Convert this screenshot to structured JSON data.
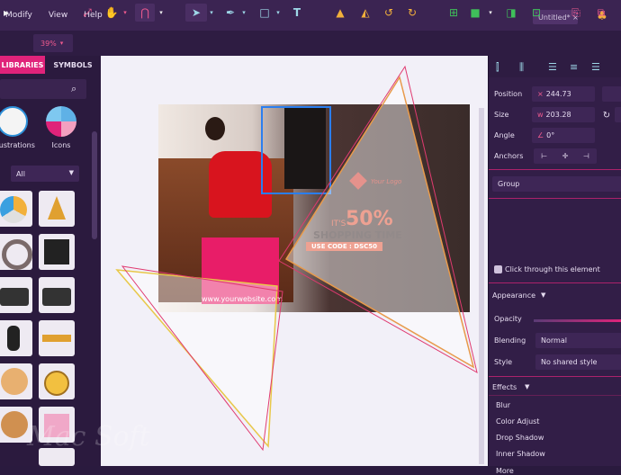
{
  "menu": [
    "Modify",
    "View",
    "Help"
  ],
  "document_tab": {
    "title": "Untitled*",
    "close": "×"
  },
  "toolbar": {
    "zoom": "39%"
  },
  "left_panel": {
    "tabs": [
      "LIBRARIES",
      "SYMBOLS"
    ],
    "categories": [
      {
        "label": "Illustrations",
        "icon": "robot-icon"
      },
      {
        "label": "Icons",
        "icon": "icons-icon"
      }
    ],
    "filter": "All"
  },
  "banner": {
    "logo_text": "Your Logo",
    "line1": "IT'S",
    "discount": "50%",
    "headline": "SHOPPING TIME",
    "code": "USE CODE : DSC50",
    "website": "www.yourwebsite.com"
  },
  "properties": {
    "position_label": "Position",
    "position_x": "244.73",
    "size_label": "Size",
    "size_w": "203.28",
    "angle_label": "Angle",
    "angle": "0°",
    "anchors_label": "Anchors",
    "group": "Group",
    "click_through": "Click through this element",
    "appearance": "Appearance",
    "opacity_label": "Opacity",
    "blending_label": "Blending",
    "blending": "Normal",
    "style_label": "Style",
    "style": "No shared style",
    "effects": "Effects",
    "effect_items": [
      "Blur",
      "Color Adjust",
      "Drop Shadow",
      "Inner Shadow",
      "More"
    ]
  },
  "watermark": "Mac Soft",
  "colors": {
    "accent": "#e0237a",
    "panel": "#2b1a3e",
    "canvas": "#f2f0f8",
    "icon": "#9ed8e8"
  }
}
